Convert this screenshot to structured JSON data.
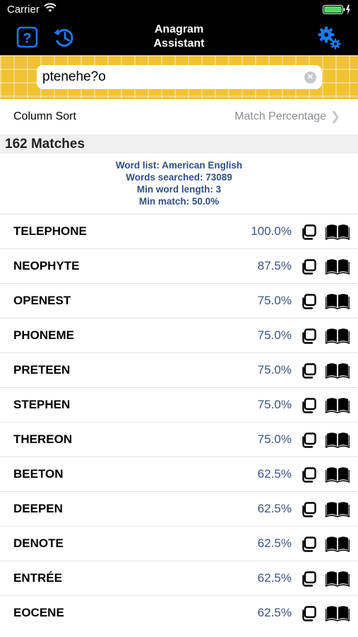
{
  "status_bar": {
    "carrier": "Carrier"
  },
  "nav": {
    "title_line1": "Anagram",
    "title_line2": "Assistant",
    "help_icon": "help-icon",
    "history_icon": "history-icon",
    "settings_icon": "gear-icon"
  },
  "search": {
    "value": "ptenehe?o"
  },
  "sort": {
    "label": "Column Sort",
    "value": "Match Percentage"
  },
  "results": {
    "count_label": "162 Matches",
    "info": {
      "word_list": "Word list: American English",
      "words_searched": "Words searched: 73089",
      "min_length": "Min word length: 3",
      "min_match": "Min match: 50.0%"
    },
    "items": [
      {
        "word": "TELEPHONE",
        "pct": "100.0%"
      },
      {
        "word": "NEOPHYTE",
        "pct": "87.5%"
      },
      {
        "word": "OPENEST",
        "pct": "75.0%"
      },
      {
        "word": "PHONEME",
        "pct": "75.0%"
      },
      {
        "word": "PRETEEN",
        "pct": "75.0%"
      },
      {
        "word": "STEPHEN",
        "pct": "75.0%"
      },
      {
        "word": "THEREON",
        "pct": "75.0%"
      },
      {
        "word": "BEETON",
        "pct": "62.5%"
      },
      {
        "word": "DEEPEN",
        "pct": "62.5%"
      },
      {
        "word": "DENOTE",
        "pct": "62.5%"
      },
      {
        "word": "ENTRÉE",
        "pct": "62.5%"
      },
      {
        "word": "EOCENE",
        "pct": "62.5%"
      }
    ]
  },
  "colors": {
    "accent": "#1E7AF0",
    "tile": "#F1C232",
    "info_text": "#2F4F85",
    "percentage": "#3B5484"
  }
}
